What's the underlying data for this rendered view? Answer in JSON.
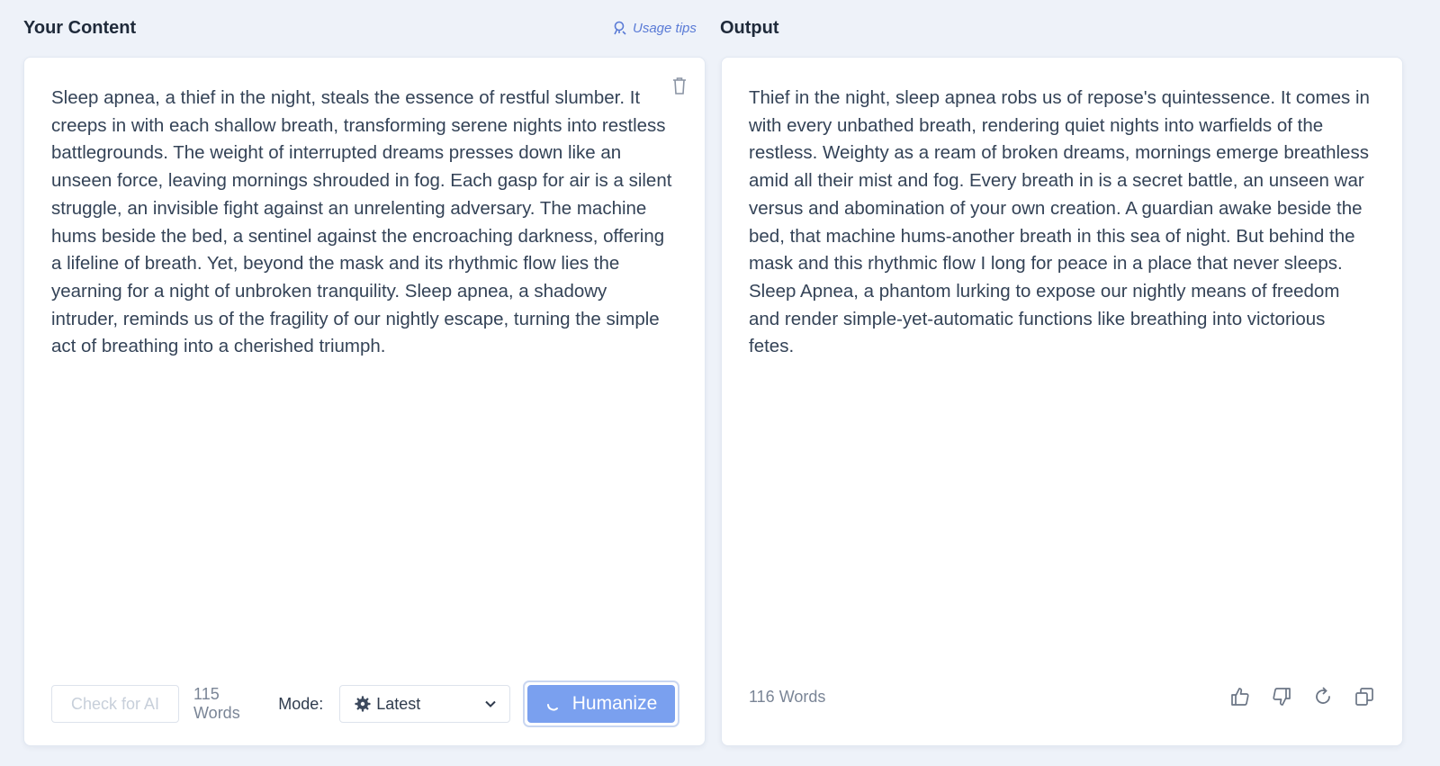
{
  "header": {
    "left_title": "Your Content",
    "right_title": "Output",
    "usage_tips": "Usage tips"
  },
  "input": {
    "text": "Sleep apnea, a thief in the night, steals the essence of restful slumber. It creeps in with each shallow breath, transforming serene nights into restless battlegrounds. The weight of interrupted dreams presses down like an unseen force, leaving mornings shrouded in fog. Each gasp for air is a silent struggle, an invisible fight against an unrelenting adversary. The machine hums beside the bed, a sentinel against the encroaching darkness, offering a lifeline of breath. Yet, beyond the mask and its rhythmic flow lies the yearning for a night of unbroken tranquility. Sleep apnea, a shadowy intruder, reminds us of the fragility of our nightly escape, turning the simple act of breathing into a cherished triumph.",
    "check_button": "Check for AI",
    "word_count": "115 Words",
    "mode_label": "Mode:",
    "mode_value": "Latest",
    "humanize_button": "Humanize"
  },
  "output": {
    "text": "Thief in the night, sleep apnea robs us of repose's quintessence. It comes in with every unbathed breath, rendering quiet nights into warfields of the restless. Weighty as a ream of broken dreams, mornings emerge breathless amid all their mist and fog. Every breath in is a secret battle, an unseen war versus and abomination of your own creation. A guardian awake beside the bed, that machine hums-another breath in this sea of night. But behind the mask and this rhythmic flow I long for peace in a place that never sleeps. Sleep Apnea, a phantom lurking to expose our nightly means of freedom and render simple-yet-automatic functions like breathing into victorious fetes.",
    "word_count": "116 Words"
  },
  "icons": {
    "usage_tips": "bulb-icon",
    "trash": "trash-icon",
    "mode": "gear-icon",
    "dropdown": "chevron-down-icon",
    "spinner": "spinner-icon",
    "thumbs_up": "thumbs-up-icon",
    "thumbs_down": "thumbs-down-icon",
    "refresh": "refresh-icon",
    "copy": "copy-icon"
  },
  "colors": {
    "accent": "#7aa0ef",
    "link": "#5a7bd6",
    "background": "#eef2f9"
  }
}
